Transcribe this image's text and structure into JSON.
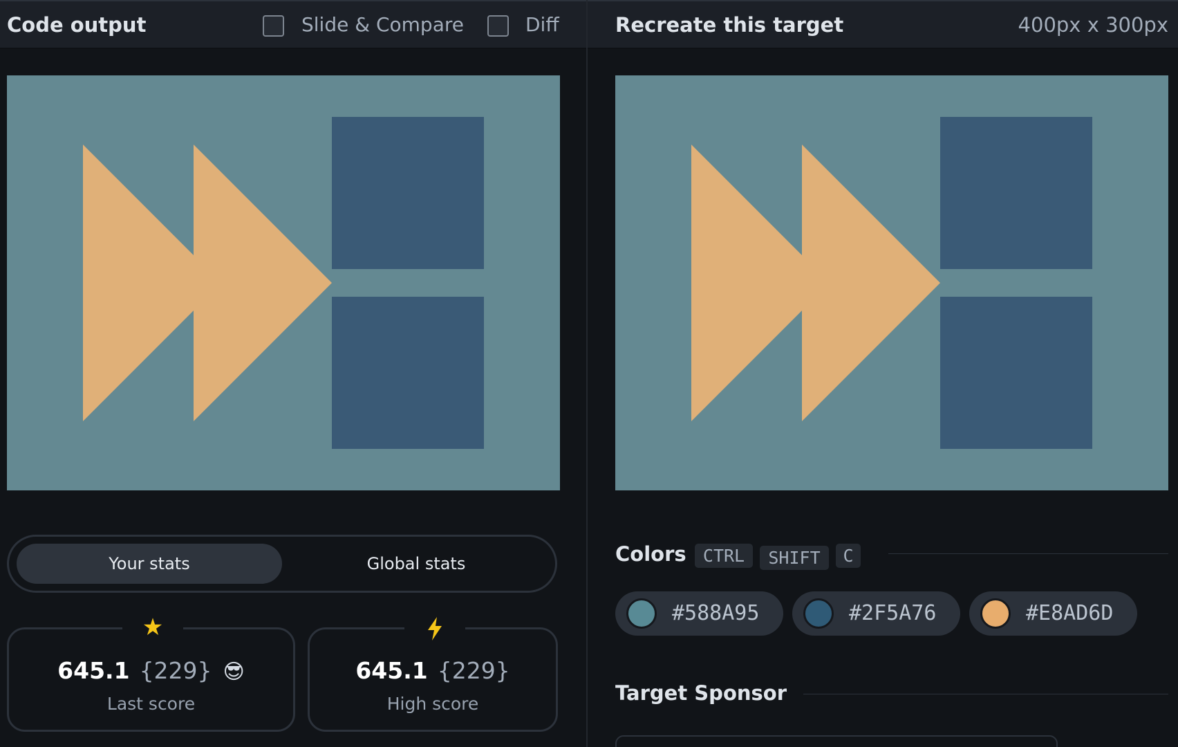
{
  "left_panel": {
    "title": "Code output",
    "toggles": [
      {
        "label": "Slide & Compare",
        "checked": false
      },
      {
        "label": "Diff",
        "checked": false
      }
    ]
  },
  "right_panel": {
    "title": "Recreate this target",
    "dimensions": "400px x 300px"
  },
  "stats_tabs": {
    "active": "Your stats",
    "tabs": [
      "Your stats",
      "Global stats"
    ]
  },
  "scores": {
    "last": {
      "value": "645.1",
      "count": "{229}",
      "emoji": "😎",
      "label": "Last score",
      "icon": "star-icon"
    },
    "high": {
      "value": "645.1",
      "count": "{229}",
      "label": "High score",
      "icon": "lightning-icon"
    }
  },
  "colors": {
    "title": "Colors",
    "shortcut": [
      "CTRL",
      "SHIFT",
      "C"
    ],
    "swatches": [
      {
        "hex": "#588A95",
        "display": "#588A95"
      },
      {
        "hex": "#2F5A76",
        "display": "#2F5A76"
      },
      {
        "hex": "#E8AD6D",
        "display": "#E8AD6D"
      }
    ]
  },
  "sponsor": {
    "title": "Target Sponsor"
  },
  "canvas_colors": {
    "background": "#648992",
    "squares": "#3a5a76",
    "triangles": "#e0b078"
  }
}
